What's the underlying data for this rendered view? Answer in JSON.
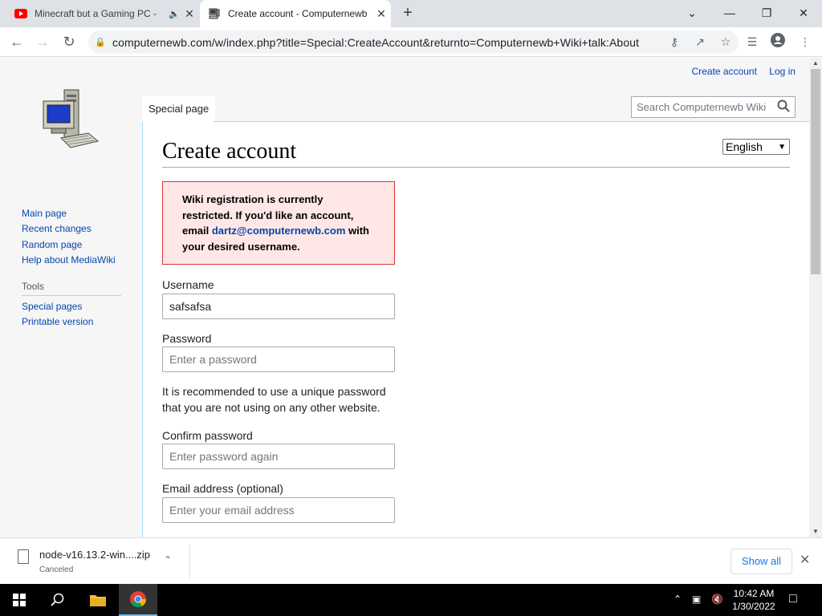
{
  "browser": {
    "tabs": [
      {
        "title": "Minecraft but a Gaming PC - ",
        "active": false
      },
      {
        "title": "Create account - Computernewb",
        "active": true
      }
    ],
    "url": "computernewb.com/w/index.php?title=Special:CreateAccount&returnto=Computernewb+Wiki+talk:About"
  },
  "wiki": {
    "personal": {
      "create_account": "Create account",
      "log_in": "Log in"
    },
    "namespace_tab": "Special page",
    "search_placeholder": "Search Computernewb Wiki",
    "sidebar": {
      "nav": [
        "Main page",
        "Recent changes",
        "Random page",
        "Help about MediaWiki"
      ],
      "tools_heading": "Tools",
      "tools": [
        "Special pages",
        "Printable version"
      ]
    },
    "title": "Create account",
    "language": "English",
    "notice": {
      "text_before": "Wiki registration is currently restricted. If you'd like an account, email ",
      "email": "dartz@computernewb.com",
      "text_after": " with your desired username."
    },
    "form": {
      "username_label": "Username",
      "username_value": "safsafsa",
      "password_label": "Password",
      "password_placeholder": "Enter a password",
      "password_help": "It is recommended to use a unique password that you are not using on any other website.",
      "confirm_label": "Confirm password",
      "confirm_placeholder": "Enter password again",
      "email_label": "Email address (optional)",
      "email_placeholder": "Enter your email address"
    }
  },
  "download": {
    "filename": "node-v16.13.2-win....zip",
    "status": "Canceled",
    "show_all": "Show all"
  },
  "taskbar": {
    "time": "10:42 AM",
    "date": "1/30/2022"
  },
  "colors": {
    "link": "#0645ad",
    "notice_bg": "#fee7e6",
    "notice_border": "#d33",
    "chrome_accent": "#1a73e8"
  }
}
